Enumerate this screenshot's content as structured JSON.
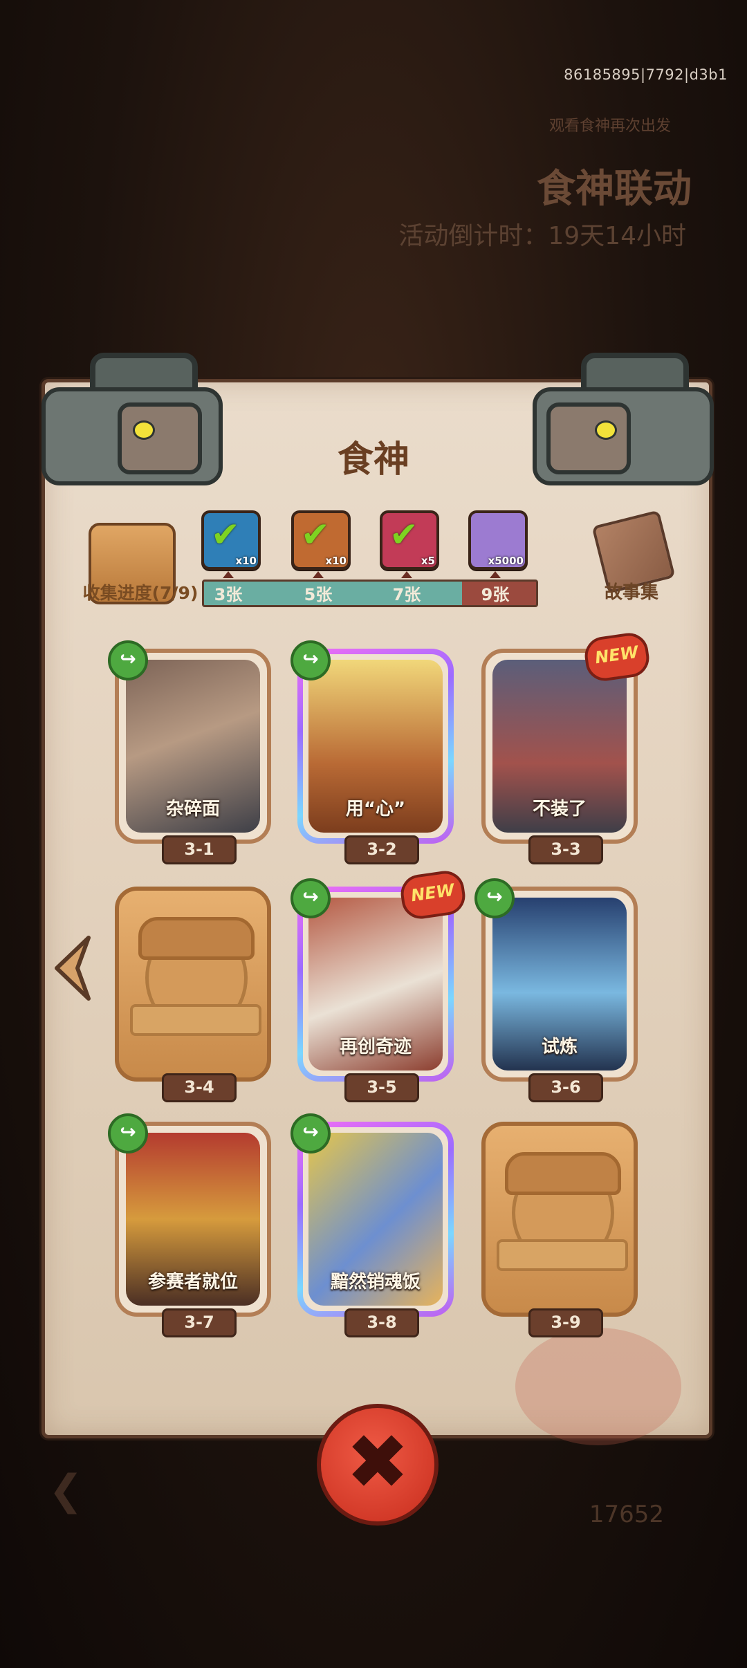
{
  "debug_id": "86185895|7792|d3b1",
  "background": {
    "event_title": "食神联动",
    "countdown": "活动倒计时：19天14小时",
    "subtitle": "观看食神再次出发",
    "coins": "17652"
  },
  "panel": {
    "title": "食神",
    "progress": {
      "label": "收集进度(7/9)",
      "fraction": 0.7778,
      "milestones": [
        {
          "count": "3张",
          "reward": "x10",
          "claimed": true,
          "color": "#2f7fb7"
        },
        {
          "count": "5张",
          "reward": "x10",
          "claimed": true,
          "color": "#c06a31"
        },
        {
          "count": "7张",
          "reward": "x5",
          "claimed": true,
          "color": "#c23b57"
        },
        {
          "count": "9张",
          "reward": "x5000",
          "claimed": false,
          "color": "#9c7bd1"
        }
      ]
    },
    "story_label": "故事集"
  },
  "cards": [
    {
      "name": "杂碎面",
      "tag": "3-1",
      "unlocked": true,
      "rare": false,
      "share": true,
      "new": false
    },
    {
      "name": "用“心”",
      "tag": "3-2",
      "unlocked": true,
      "rare": true,
      "share": true,
      "new": false
    },
    {
      "name": "不装了",
      "tag": "3-3",
      "unlocked": true,
      "rare": false,
      "share": false,
      "new": true
    },
    {
      "name": "",
      "tag": "3-4",
      "unlocked": false,
      "rare": false,
      "share": false,
      "new": false
    },
    {
      "name": "再创奇迹",
      "tag": "3-5",
      "unlocked": true,
      "rare": true,
      "share": true,
      "new": true
    },
    {
      "name": "试炼",
      "tag": "3-6",
      "unlocked": true,
      "rare": false,
      "share": true,
      "new": false
    },
    {
      "name": "参赛者就位",
      "tag": "3-7",
      "unlocked": true,
      "rare": false,
      "share": true,
      "new": false
    },
    {
      "name": "黯然销魂饭",
      "tag": "3-8",
      "unlocked": true,
      "rare": true,
      "share": true,
      "new": false
    },
    {
      "name": "",
      "tag": "3-9",
      "unlocked": false,
      "rare": false,
      "share": false,
      "new": false
    }
  ],
  "badges": {
    "new_text": "NEW",
    "share_glyph": "↪"
  },
  "close_glyph": "✖",
  "nav_glyph": "❮"
}
